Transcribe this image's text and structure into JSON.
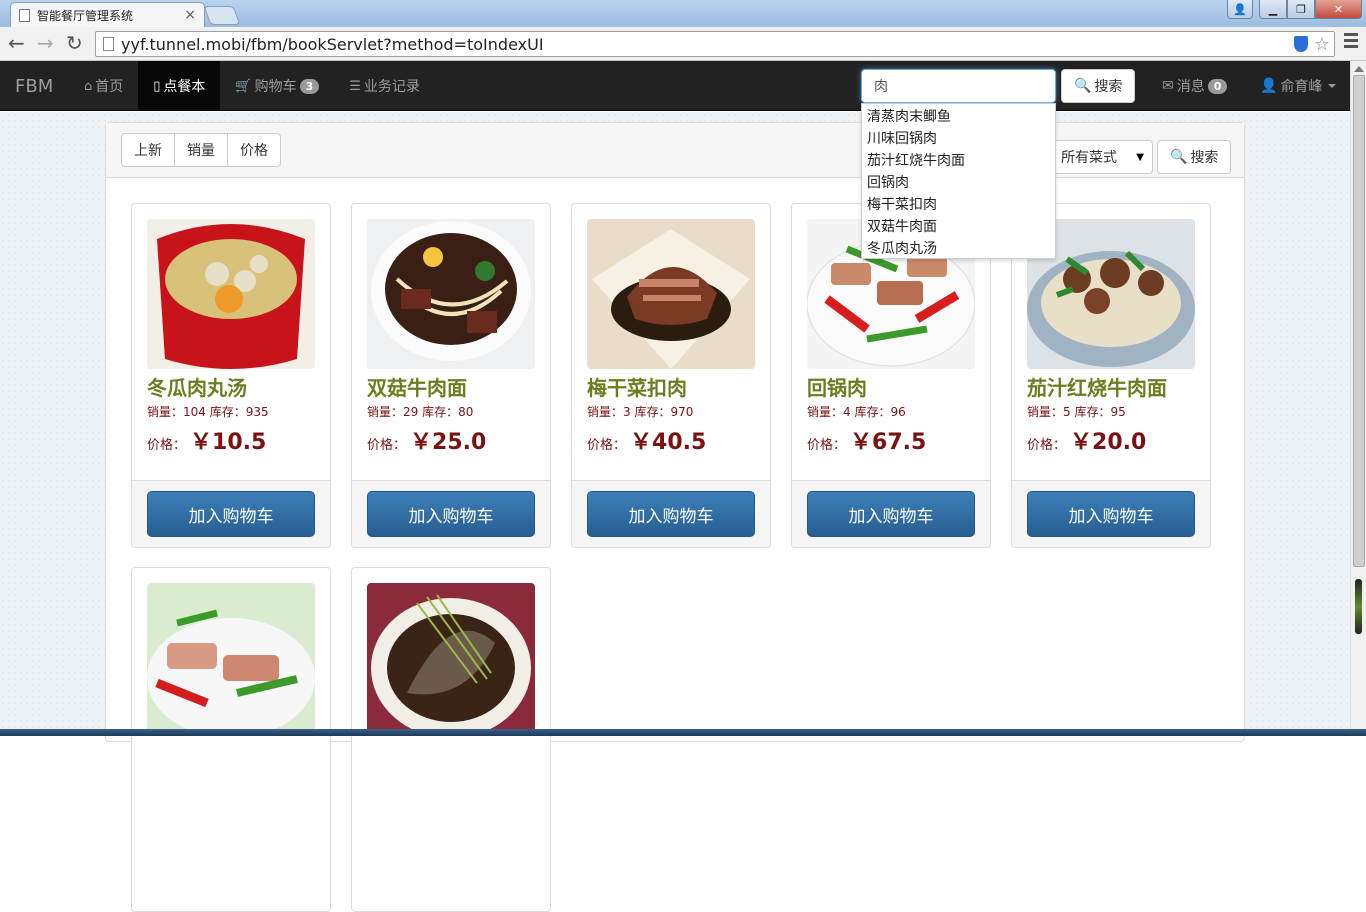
{
  "browser": {
    "tab_title": "智能餐厅管理系统",
    "url": "yyf.tunnel.mobi/fbm/bookServlet?method=toIndexUI"
  },
  "navbar": {
    "brand": "FBM",
    "items": [
      {
        "label": "首页",
        "icon": "home-icon"
      },
      {
        "label": "点餐本",
        "icon": "book-icon",
        "active": true
      },
      {
        "label": "购物车",
        "icon": "cart-icon",
        "badge": "3"
      },
      {
        "label": "业务记录",
        "icon": "list-icon"
      }
    ],
    "search_value": "肉",
    "search_button": "搜索",
    "messages_label": "消息",
    "messages_badge": "0",
    "user_name": "俞育峰"
  },
  "autocomplete": [
    "清蒸肉末鲫鱼",
    "川味回锅肉",
    "茄汁红烧牛肉面",
    "回锅肉",
    "梅干菜扣肉",
    "双菇牛肉面",
    "冬瓜肉丸汤"
  ],
  "toolbar": {
    "sort_buttons": [
      "上新",
      "销量",
      "价格"
    ],
    "category_select": "所有菜式",
    "search_button": "搜索"
  },
  "labels": {
    "sales": "销量：",
    "stock": "库存：",
    "price": "价格：",
    "currency": "￥",
    "add_to_cart": "加入购物车"
  },
  "dishes": [
    {
      "name": "冬瓜肉丸汤",
      "sales": "104",
      "stock": "935",
      "price": "10.5"
    },
    {
      "name": "双菇牛肉面",
      "sales": "29",
      "stock": "80",
      "price": "25.0"
    },
    {
      "name": "梅干菜扣肉",
      "sales": "3",
      "stock": "970",
      "price": "40.5"
    },
    {
      "name": "回锅肉",
      "sales": "4",
      "stock": "96",
      "price": "67.5"
    },
    {
      "name": "茄汁红烧牛肉面",
      "sales": "5",
      "stock": "95",
      "price": "20.0"
    }
  ]
}
